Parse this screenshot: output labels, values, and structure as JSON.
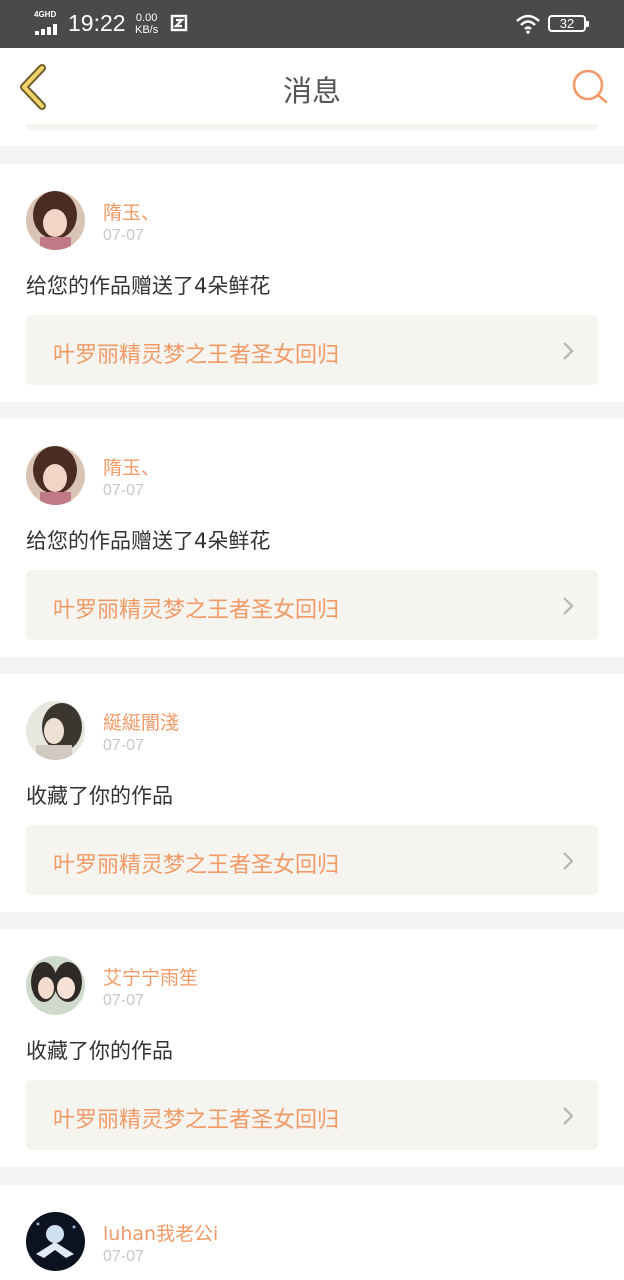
{
  "status_bar": {
    "network": "4GHD",
    "time": "19:22",
    "speed_value": "0.00",
    "speed_unit": "KB/s",
    "battery": "32"
  },
  "header": {
    "title": "消息"
  },
  "messages": [
    {
      "username": "隋玉、",
      "date": "07-07",
      "text": "给您的作品赠送了4朵鲜花",
      "work_title": "叶罗丽精灵梦之王者圣女回归"
    },
    {
      "username": "隋玉、",
      "date": "07-07",
      "text": "给您的作品赠送了4朵鲜花",
      "work_title": "叶罗丽精灵梦之王者圣女回归"
    },
    {
      "username": "綖綖闇淺",
      "date": "07-07",
      "text": "收藏了你的作品",
      "work_title": "叶罗丽精灵梦之王者圣女回归"
    },
    {
      "username": "艾宁宁雨笙",
      "date": "07-07",
      "text": "收藏了你的作品",
      "work_title": "叶罗丽精灵梦之王者圣女回归"
    },
    {
      "username": "luhan我老公i",
      "date": "07-07"
    }
  ],
  "colors": {
    "accent": "#f29a67",
    "card_bg": "#f5f4ef",
    "status_bar": "#4a4a4a"
  },
  "icons": [
    "back-arrow-icon",
    "search-icon",
    "chevron-right-icon",
    "avatar"
  ]
}
